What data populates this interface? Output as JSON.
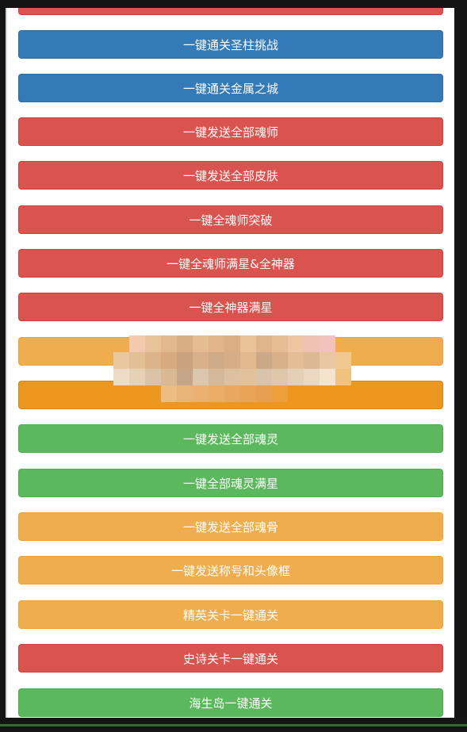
{
  "buttons": [
    {
      "label": "",
      "color": "red"
    },
    {
      "label": "一键通关圣柱挑战",
      "color": "blue"
    },
    {
      "label": "一键通关金属之城",
      "color": "blue"
    },
    {
      "label": "一键发送全部魂师",
      "color": "red"
    },
    {
      "label": "一键发送全部皮肤",
      "color": "red"
    },
    {
      "label": "一键全魂师突破",
      "color": "red"
    },
    {
      "label": "一键全魂师满星&全神器",
      "color": "red"
    },
    {
      "label": "一键全神器满星",
      "color": "red"
    },
    {
      "label": "",
      "color": "orange"
    },
    {
      "label": "一键全暗器满突破",
      "color": "darkorange"
    },
    {
      "label": "一键发送全部魂灵",
      "color": "green"
    },
    {
      "label": "一键全部魂灵满星",
      "color": "green"
    },
    {
      "label": "一键发送全部魂骨",
      "color": "orange"
    },
    {
      "label": "一键发送称号和头像框",
      "color": "orange"
    },
    {
      "label": "精英关卡一键通关",
      "color": "orange"
    },
    {
      "label": "史诗关卡一键通关",
      "color": "red"
    },
    {
      "label": "海生岛一键通关",
      "color": "green"
    }
  ],
  "colors": {
    "blue": "#337ab7",
    "red": "#d9534f",
    "orange": "#f0ad4e",
    "darkorange": "#ec971f",
    "green": "#5cb85c"
  }
}
